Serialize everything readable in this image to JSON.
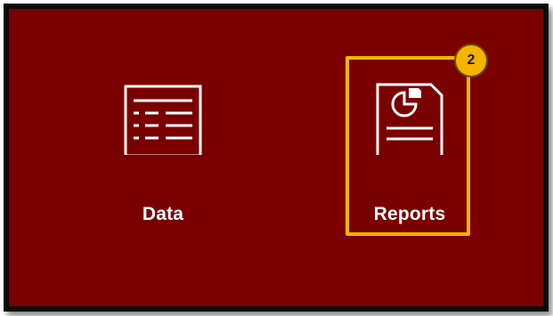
{
  "tiles": [
    {
      "label": "Data",
      "icon": "table-icon"
    },
    {
      "label": "Reports",
      "icon": "report-icon"
    }
  ],
  "callout": {
    "number": "2",
    "color": "#f4b400"
  },
  "colors": {
    "background": "#7a0000",
    "frame_border": "#0b0b0b",
    "text": "#ffffff"
  }
}
